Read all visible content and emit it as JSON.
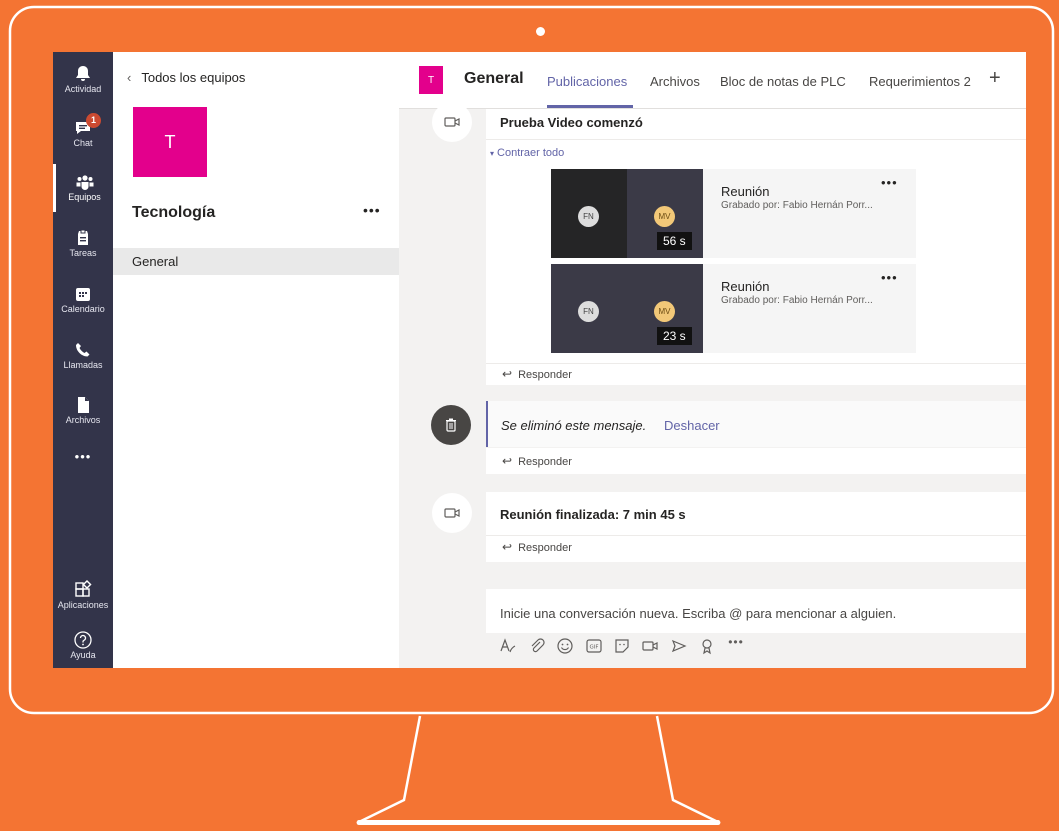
{
  "rail": {
    "items": [
      {
        "label": "Actividad",
        "icon": "bell-icon"
      },
      {
        "label": "Chat",
        "icon": "chat-icon",
        "badge": "1"
      },
      {
        "label": "Equipos",
        "icon": "teams-icon"
      },
      {
        "label": "Tareas",
        "icon": "tasks-icon"
      },
      {
        "label": "Calendario",
        "icon": "calendar-icon"
      },
      {
        "label": "Llamadas",
        "icon": "phone-icon"
      },
      {
        "label": "Archivos",
        "icon": "file-icon"
      },
      {
        "label": "•••",
        "icon": "more-icon"
      },
      {
        "label": "Aplicaciones",
        "icon": "apps-icon"
      },
      {
        "label": "Ayuda",
        "icon": "help-icon"
      }
    ],
    "active": "Equipos"
  },
  "team_panel": {
    "back_label": "Todos los equipos",
    "avatar_letter": "T",
    "team_name": "Tecnología",
    "more": "•••",
    "channel": "General"
  },
  "header": {
    "avatar_letter": "T",
    "title": "General",
    "tabs": [
      "Publicaciones",
      "Archivos",
      "Bloc de notas de PLC",
      "Requerimientos 2"
    ],
    "active_tab": "Publicaciones",
    "add": "+"
  },
  "messages": {
    "video_started": "Prueba Video comenzó",
    "collapse": "Contraer todo",
    "recordings": [
      {
        "title": "Reunión",
        "sub": "Grabado por: Fabio Hernán Porr...",
        "duration": "56 s",
        "a1": "FN",
        "a2": "MV",
        "more": "•••"
      },
      {
        "title": "Reunión",
        "sub": "Grabado por: Fabio Hernán Porr...",
        "duration": "23 s",
        "a1": "FN",
        "a2": "MV",
        "more": "•••"
      }
    ],
    "reply": "Responder",
    "deleted": "Se eliminó este mensaje.",
    "undo": "Deshacer",
    "meeting_ended": "Reunión finalizada: 7 min 45 s"
  },
  "compose": {
    "placeholder": "Inicie una conversación nueva. Escriba @ para mencionar a alguien.",
    "tools": [
      "format-icon",
      "attach-icon",
      "emoji-icon",
      "gif-icon",
      "sticker-icon",
      "meet-icon",
      "send-icon",
      "praise-icon",
      "more-icon"
    ],
    "more": "•••"
  },
  "colors": {
    "background": "#f47433",
    "brand": "#6264a7",
    "rail": "#33344a",
    "team_avatar": "#e3008c"
  }
}
